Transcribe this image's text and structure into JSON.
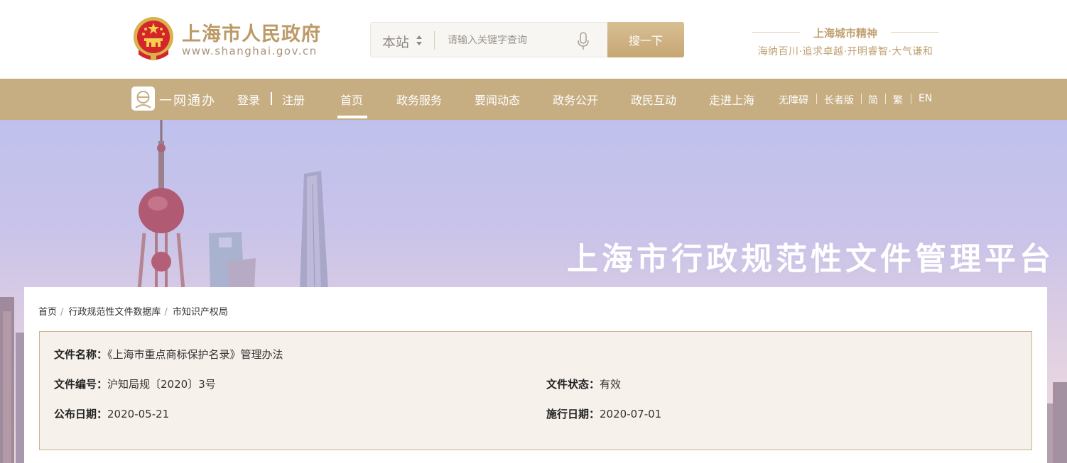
{
  "header": {
    "site_title": "上海市人民政府",
    "site_url": "www.shanghai.gov.cn",
    "search": {
      "scope": "本站",
      "placeholder": "请输入关键字查询",
      "button_label": "搜一下"
    },
    "spirit": {
      "title": "上海城市精神",
      "motto": "海纳百川·追求卓越·开明睿智·大气谦和"
    }
  },
  "nav": {
    "onenet_label": "一网通办",
    "login_label": "登录",
    "register_label": "注册",
    "items": [
      {
        "label": "首页",
        "active": true
      },
      {
        "label": "政务服务",
        "active": false
      },
      {
        "label": "要闻动态",
        "active": false
      },
      {
        "label": "政务公开",
        "active": false
      },
      {
        "label": "政民互动",
        "active": false
      },
      {
        "label": "走进上海",
        "active": false
      }
    ],
    "utilities": [
      "无障碍",
      "长者版",
      "简",
      "繁",
      "EN"
    ]
  },
  "banner": {
    "title": "上海市行政规范性文件管理平台"
  },
  "breadcrumb": [
    "首页",
    "行政规范性文件数据库",
    "市知识产权局"
  ],
  "document": {
    "name_label": "文件名称：",
    "name_value": "《上海市重点商标保护名录》管理办法",
    "number_label": "文件编号：",
    "number_value": "沪知局规〔2020〕3号",
    "status_label": "文件状态：",
    "status_value": "有效",
    "publish_label": "公布日期：",
    "publish_value": "2020-05-21",
    "effective_label": "施行日期：",
    "effective_value": "2020-07-01"
  },
  "colors": {
    "accent_gold": "#c6ad82",
    "title_gold": "#bb9a66",
    "info_bg": "#f6f1ea",
    "info_border": "#c9b58f",
    "emblem_red": "#d4252b"
  }
}
